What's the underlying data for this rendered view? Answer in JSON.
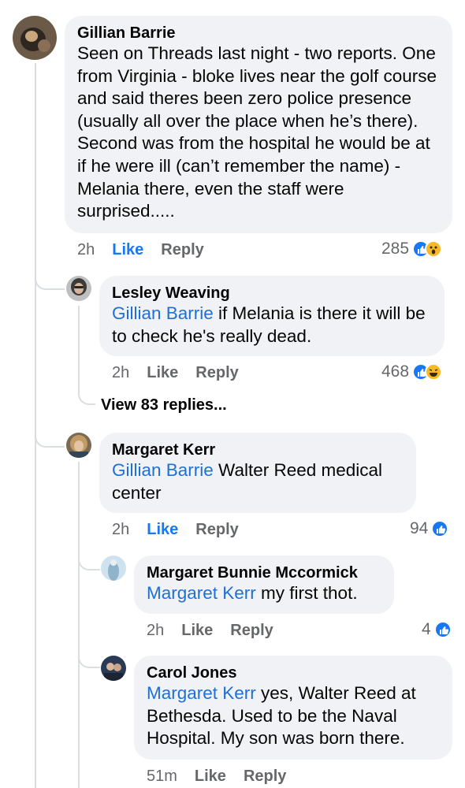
{
  "comments": [
    {
      "author": "Gillian Barrie",
      "text": "Seen on Threads last night - two reports. One from Virginia - bloke lives near the golf course and said theres been zero police presence (usually all over the place when he’s there). Second was from the hospital he would be at if he were ill (can’t remember the name) - Melania there, even the staff were surprised.....",
      "time": "2h",
      "like": "Like",
      "reply": "Reply",
      "reaction_count": "285",
      "reaction_icons": [
        "like-icon",
        "wow-icon"
      ]
    },
    {
      "author": "Lesley Weaving",
      "mention": "Gillian Barrie",
      "text": " if Melania is there it will be to check he's really dead.",
      "time": "2h",
      "like": "Like",
      "reply": "Reply",
      "reaction_count": "468",
      "reaction_icons": [
        "like-icon",
        "haha-icon"
      ]
    },
    {
      "view_replies": "View 83 replies..."
    },
    {
      "author": "Margaret Kerr",
      "mention": "Gillian Barrie",
      "text": " Walter Reed medical center",
      "time": "2h",
      "like": "Like",
      "reply": "Reply",
      "reaction_count": "94",
      "reaction_icons": [
        "like-icon"
      ]
    },
    {
      "author": "Margaret Bunnie Mccormick",
      "mention": "Margaret Kerr",
      "text": " my first thot.",
      "time": "2h",
      "like": "Like",
      "reply": "Reply",
      "reaction_count": "4",
      "reaction_icons": [
        "like-icon"
      ]
    },
    {
      "author": "Carol Jones",
      "mention": "Margaret Kerr",
      "text": " yes, Walter Reed at Bethesda. Used to be the Naval Hospital. My son was born there.",
      "time": "51m",
      "like": "Like",
      "reply": "Reply"
    }
  ],
  "colors": {
    "bubble": "#f0f2f5",
    "mention": "#1f6fd6",
    "like_active": "#1877f2",
    "meta": "#65676b"
  }
}
